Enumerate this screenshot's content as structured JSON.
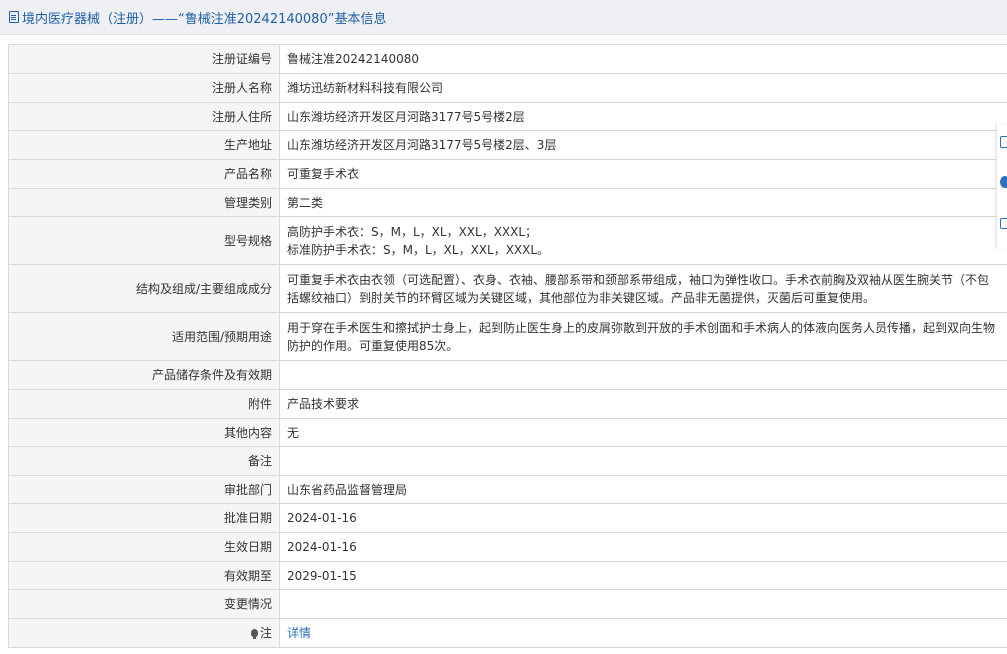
{
  "header": {
    "title": "境内医疗器械（注册）——“鲁械注准20242140080”基本信息"
  },
  "rows": [
    {
      "label": "注册证编号",
      "value": "鲁械注准20242140080"
    },
    {
      "label": "注册人名称",
      "value": "潍坊迅纺新材料科技有限公司"
    },
    {
      "label": "注册人住所",
      "value": "山东潍坊经济开发区月河路3177号5号楼2层"
    },
    {
      "label": "生产地址",
      "value": "山东潍坊经济开发区月河路3177号5号楼2层、3层"
    },
    {
      "label": "产品名称",
      "value": "可重复手术衣"
    },
    {
      "label": "管理类别",
      "value": "第二类"
    },
    {
      "label": "型号规格",
      "value_lines": [
        "高防护手术衣：S，M，L，XL，XXL，XXXL；",
        "标准防护手术衣：S，M，L，XL，XXL，XXXL。"
      ]
    },
    {
      "label": "结构及组成/主要组成成分",
      "value_lines": [
        "可重复手术衣由衣领（可选配置）、衣身、衣袖、腰部系带和颈部系带组成，袖口为弹性收口。手术衣前胸及双袖从医生腕关节（不包",
        "括螺纹袖口）到肘关节的环臂区域为关键区域，其他部位为非关键区域。产品非无菌提供，灭菌后可重复使用。"
      ]
    },
    {
      "label": "适用范围/预期用途",
      "value_lines": [
        "用于穿在手术医生和擦拭护士身上，起到防止医生身上的皮屑弥散到开放的手术创面和手术病人的体液向医务人员传播，起到双向生物",
        "防护的作用。可重复使用85次。"
      ]
    },
    {
      "label": "产品储存条件及有效期",
      "value": ""
    },
    {
      "label": "附件",
      "value": "产品技术要求"
    },
    {
      "label": "其他内容",
      "value": "无"
    },
    {
      "label": "备注",
      "value": ""
    },
    {
      "label": "审批部门",
      "value": "山东省药品监督管理局"
    },
    {
      "label": "批准日期",
      "value": "2024-01-16"
    },
    {
      "label": "生效日期",
      "value": "2024-01-16"
    },
    {
      "label": "有效期至",
      "value": "2029-01-15"
    },
    {
      "label": "变更情况",
      "value": ""
    },
    {
      "label": "注",
      "value": "详情",
      "icon": "lightbulb-icon"
    }
  ],
  "side_tools": [
    "document-icon",
    "circle-icon",
    "copy-icon"
  ],
  "colors": {
    "header_bg": "#eef0f4",
    "header_text": "#1f5fa8",
    "label_bg": "#f4f5f7",
    "border": "#d6d9df",
    "link": "#2a6fc0"
  }
}
